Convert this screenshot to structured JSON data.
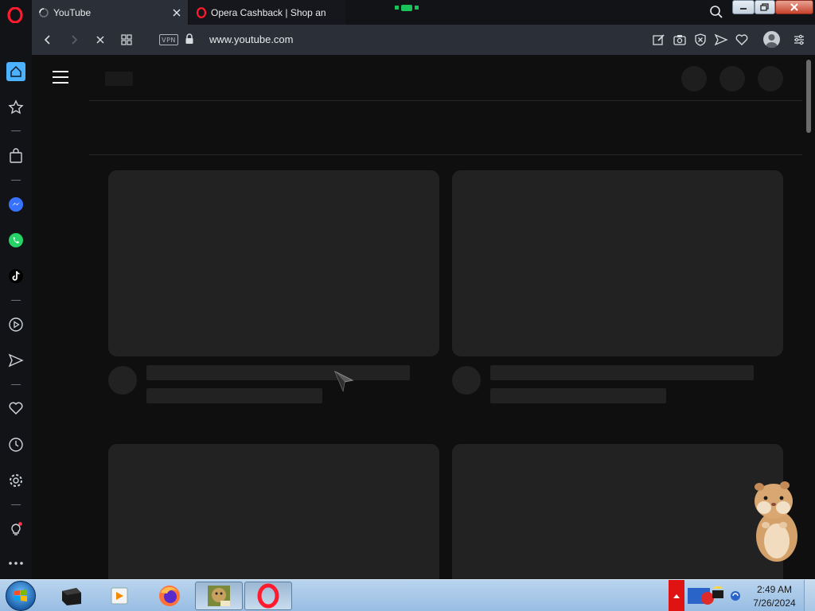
{
  "tabs": [
    {
      "title": "YouTube",
      "active": true
    },
    {
      "title": "Opera Cashback | Shop an",
      "active": false
    }
  ],
  "address_bar": {
    "vpn_label": "VPN",
    "url": "www.youtube.com"
  },
  "sidebar": {
    "items": [
      "home-icon",
      "star-icon",
      "bag-icon",
      "messenger-icon",
      "whatsapp-icon",
      "tiktok-icon",
      "player-icon",
      "send-icon",
      "heart-icon",
      "history-icon",
      "settings-icon",
      "tips-icon",
      "more-icon"
    ]
  },
  "taskbar": {
    "apps": [
      "cmd-icon",
      "media-player-icon",
      "firefox-icon",
      "game-box-icon",
      "opera-icon"
    ],
    "clock": {
      "time": "2:49 AM",
      "date": "7/26/2024"
    }
  },
  "colors": {
    "accent": "#4cb2ff",
    "page_bg": "#0f0f0f",
    "skeleton": "#222222"
  }
}
